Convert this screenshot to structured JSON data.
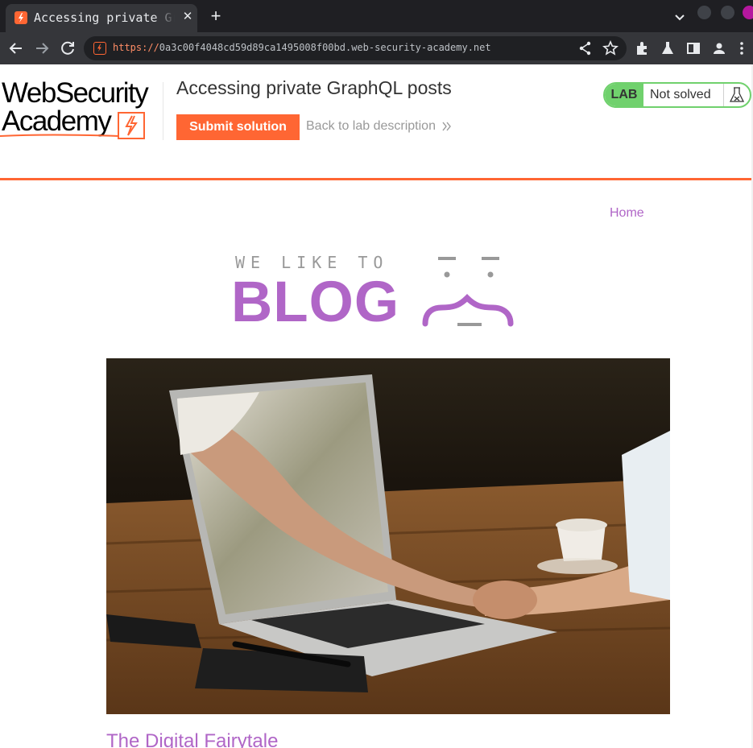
{
  "browser": {
    "tab_title": "Accessing private GraphQL posts",
    "tab_close": "✕",
    "new_tab": "+",
    "url_scheme": "https://",
    "url_host": "0a3c00f4048cd59d89ca1495008f00bd.web-security-academy.net"
  },
  "header": {
    "logo_line1": "WebSecurity",
    "logo_line2": "Academy",
    "title": "Accessing private GraphQL posts",
    "submit_label": "Submit solution",
    "back_label": "Back to lab description",
    "status_badge": "LAB",
    "status_text": "Not solved"
  },
  "nav": {
    "home": "Home"
  },
  "blog": {
    "tagline": "WE LIKE TO",
    "word": "BLOG"
  },
  "post": {
    "title": "The Digital Fairytale"
  },
  "colors": {
    "accent": "#ff6633",
    "brand_purple": "#b066c7",
    "status_green": "#70d16d"
  },
  "icons": [
    "back-arrow-icon",
    "forward-arrow-icon",
    "reload-icon",
    "site-favicon-icon",
    "share-icon",
    "star-icon",
    "extensions-icon",
    "lab-flask-icon",
    "side-panel-icon",
    "profile-icon",
    "menu-icon",
    "chevron-right-icon"
  ]
}
